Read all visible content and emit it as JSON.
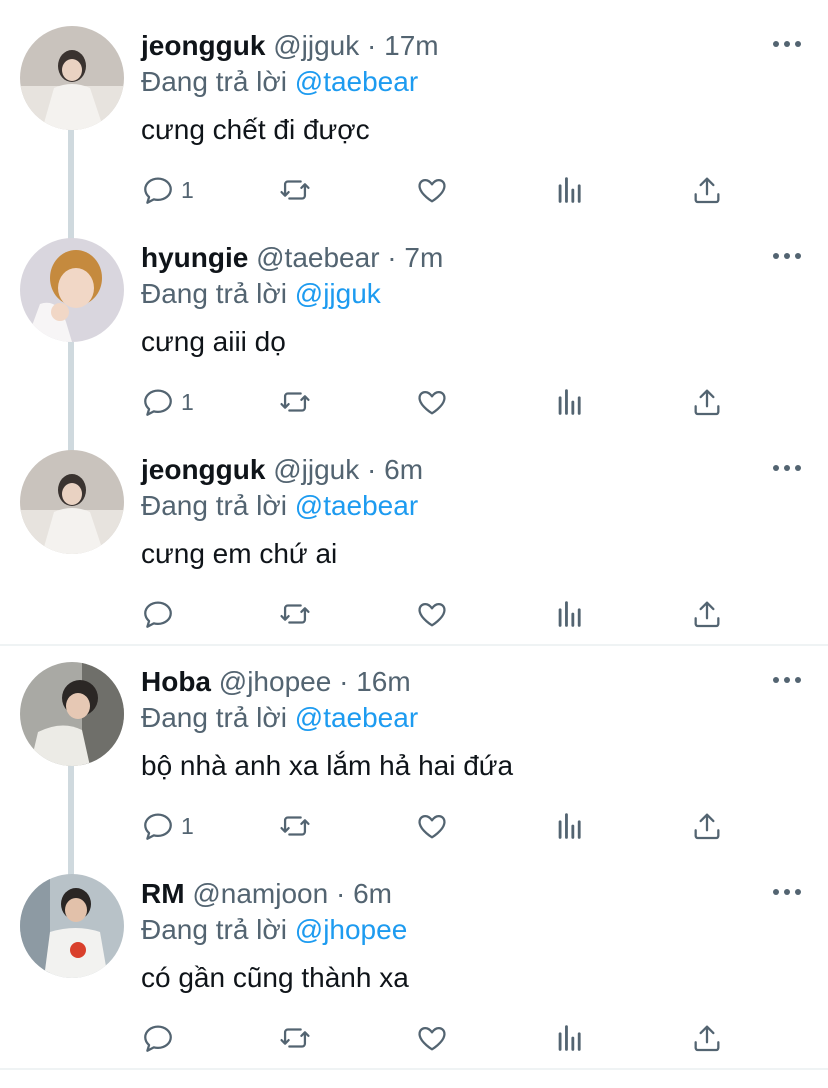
{
  "reply_prefix": "Đang trả lời",
  "tweets": [
    {
      "name": "jeongguk",
      "handle": "@jjguk",
      "dot": "·",
      "time": "17m",
      "reply_to": "@taebear",
      "text": "cưng chết đi được",
      "reply_count": "1",
      "avatar": "avatar-jeongguk"
    },
    {
      "name": "hyungie",
      "handle": "@taebear",
      "dot": "·",
      "time": "7m",
      "reply_to": "@jjguk",
      "text": "cưng aiii dọ",
      "reply_count": "1",
      "avatar": "avatar-hyungie"
    },
    {
      "name": "jeongguk",
      "handle": "@jjguk",
      "dot": "·",
      "time": "6m",
      "reply_to": "@taebear",
      "text": "cưng em chứ ai",
      "reply_count": "",
      "avatar": "avatar-jeongguk"
    },
    {
      "name": "Hoba",
      "handle": "@jhopee",
      "dot": "·",
      "time": "16m",
      "reply_to": "@taebear",
      "text": "bộ nhà anh xa lắm hả hai đứa",
      "reply_count": "1",
      "avatar": "avatar-hoba"
    },
    {
      "name": "RM",
      "handle": "@namjoon",
      "dot": "·",
      "time": "6m",
      "reply_to": "@jhopee",
      "text": "có gần cũng thành xa",
      "reply_count": "",
      "avatar": "avatar-rm"
    }
  ],
  "icons": {
    "reply": "reply-icon",
    "retweet": "retweet-icon",
    "like": "heart-icon",
    "analytics": "analytics-icon",
    "share": "share-icon",
    "more": "more-icon"
  },
  "colors": {
    "text": "#0f1419",
    "secondary": "#536471",
    "accent": "#1d9bf0",
    "thread_line": "#cfd9de",
    "divider": "#eff3f4"
  }
}
